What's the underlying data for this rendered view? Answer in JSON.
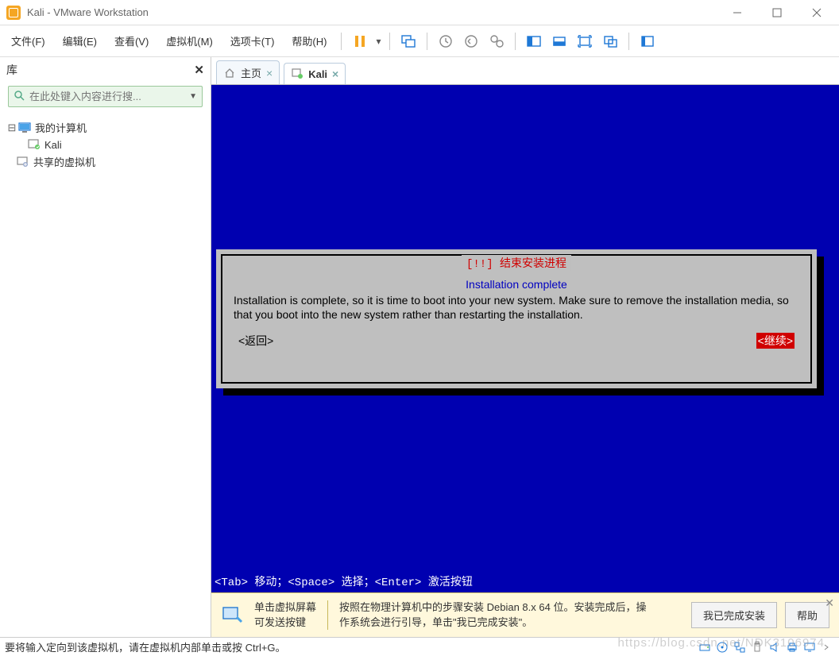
{
  "window": {
    "title": "Kali - VMware Workstation"
  },
  "menu": {
    "file": "文件(F)",
    "edit": "编辑(E)",
    "view": "查看(V)",
    "vm": "虚拟机(M)",
    "tabs": "选项卡(T)",
    "help": "帮助(H)"
  },
  "sidebar": {
    "title": "库",
    "search_placeholder": "在此处键入内容进行搜...",
    "tree": {
      "root": "我的计算机",
      "item1": "Kali",
      "shared": "共享的虚拟机"
    }
  },
  "tabs": {
    "home": "主页",
    "kali": "Kali"
  },
  "installer": {
    "frame_title": "[!!] 结束安装进程",
    "subtitle": "Installation complete",
    "body": "Installation is complete, so it is time to boot into your new system. Make sure to remove the installation media, so that you boot into the new system rather than restarting the installation.",
    "back": "<返回>",
    "continue": "<继续>"
  },
  "vm_hint": "<Tab> 移动；<Space> 选择；<Enter> 激活按钮",
  "notice": {
    "text1a": "单击虚拟屏幕",
    "text1b": "可发送按键",
    "text2": "按照在物理计算机中的步骤安装 Debian 8.x 64 位。安装完成后，操作系统会进行引导，单击\"我已完成安装\"。",
    "btn_done": "我已完成安装",
    "btn_help": "帮助"
  },
  "statusbar": {
    "text": "要将输入定向到该虚拟机，请在虚拟机内部单击或按 Ctrl+G。"
  },
  "watermark": "https://blog.csdn.net/NDK3106974"
}
